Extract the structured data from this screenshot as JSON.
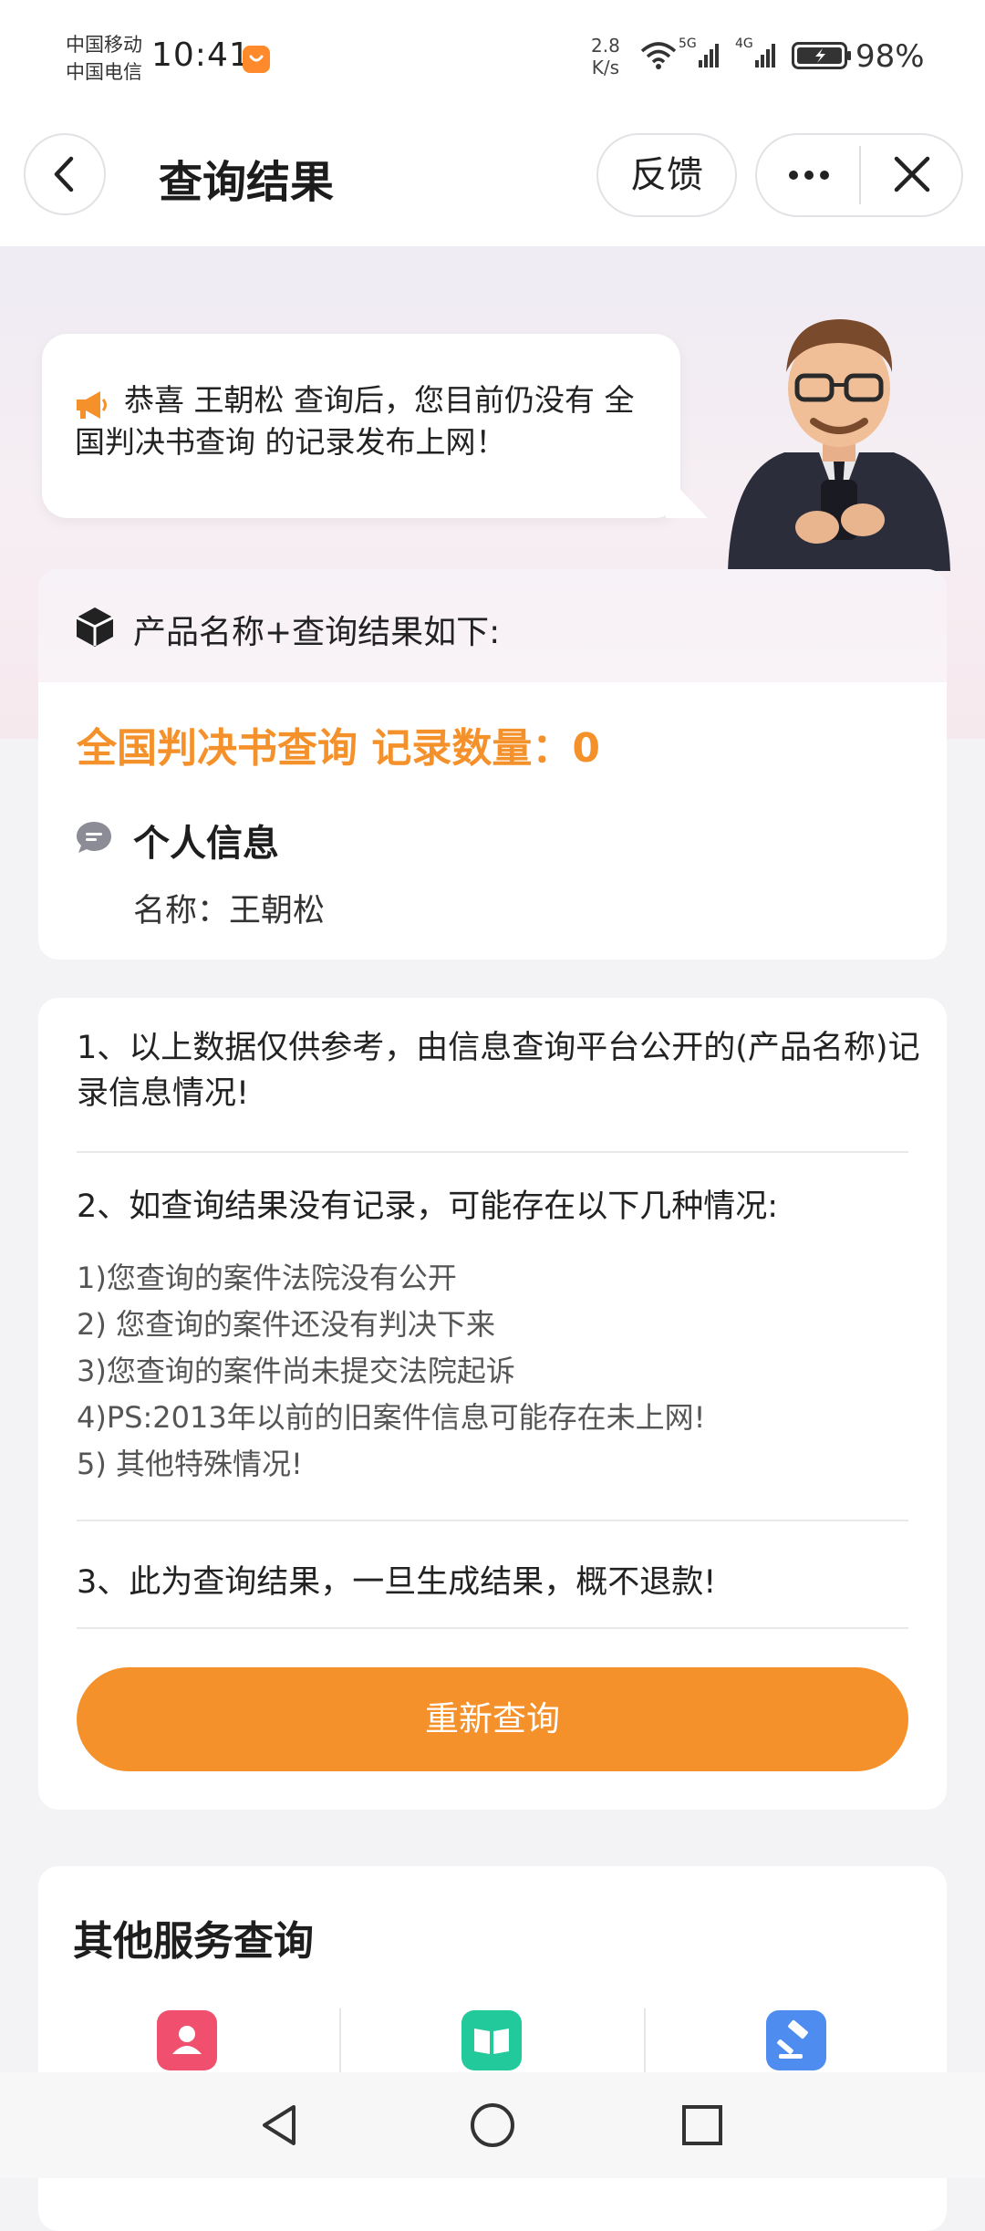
{
  "status_bar": {
    "carrier1": "中国移动",
    "carrier2": "中国电信",
    "time": "10:41",
    "net_speed_value": "2.8",
    "net_speed_unit": "K/s",
    "signal1_label": "5G",
    "signal2_label": "4G",
    "battery": "98%"
  },
  "nav": {
    "title": "查询结果",
    "feedback_label": "反馈"
  },
  "hero": {
    "message": "恭喜 王朝松 查询后，您目前仍没有 全国判决书查询 的记录发布上网！"
  },
  "result_card": {
    "header": "产品名称+查询结果如下:",
    "result_line": "全国判决书查询 记录数量：0",
    "personal_info_title": "个人信息",
    "name_line": "名称：王朝松"
  },
  "notes": {
    "note1": "1、以上数据仅供参考，由信息查询平台公开的(产品名称)记录信息情况!",
    "note2": "2、如查询结果没有记录，可能存在以下几种情况:",
    "cases": [
      "1)您查询的案件法院没有公开",
      "2) 您查询的案件还没有判决下来",
      "3)您查询的案件尚未提交法院起诉",
      "4)PS:2013年以前的旧案件信息可能存在未上网!",
      "5) 其他特殊情况!"
    ],
    "note3": "3、此为查询结果，一旦生成结果，概不退款!",
    "retry_label": "重新查询"
  },
  "other_services": {
    "title": "其他服务查询",
    "icons": [
      "person-icon",
      "book-icon",
      "gavel-icon"
    ]
  },
  "colors": {
    "accent": "#f5912b",
    "icon_person": "#f0506e",
    "icon_book": "#22c99a",
    "icon_gavel": "#4f8cf0"
  }
}
